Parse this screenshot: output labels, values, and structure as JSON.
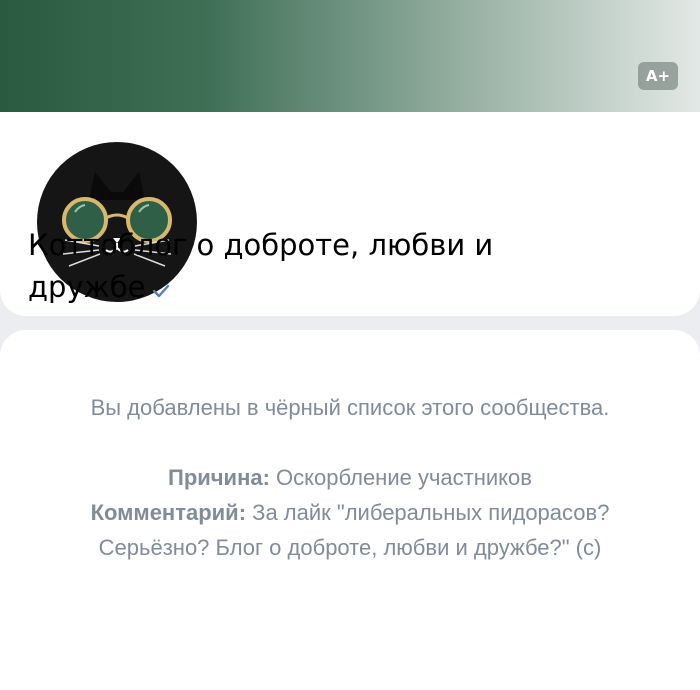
{
  "header": {
    "font_size_badge": "A+",
    "title": "Коттоблог о доброте, любви и дружбе",
    "verified": true,
    "cover_colors": [
      "#2a5a40",
      "#e3e9e6"
    ]
  },
  "message": {
    "intro": "Вы добавлены в чёрный список этого сообщества.",
    "reason_label": "Причина:",
    "reason_value": "Оскорбление участников",
    "comment_label": "Комментарий:",
    "comment_value": "За лайк \"либеральных пидорасов? Серьёзно? Блог о доброте, любви и дружбе?\" (с)"
  },
  "icons": {
    "verified": "checkmark-icon",
    "avatar": "cat-with-glasses-icon"
  },
  "colors": {
    "text_secondary": "#818c99",
    "verified_blue": "#5181b8"
  }
}
